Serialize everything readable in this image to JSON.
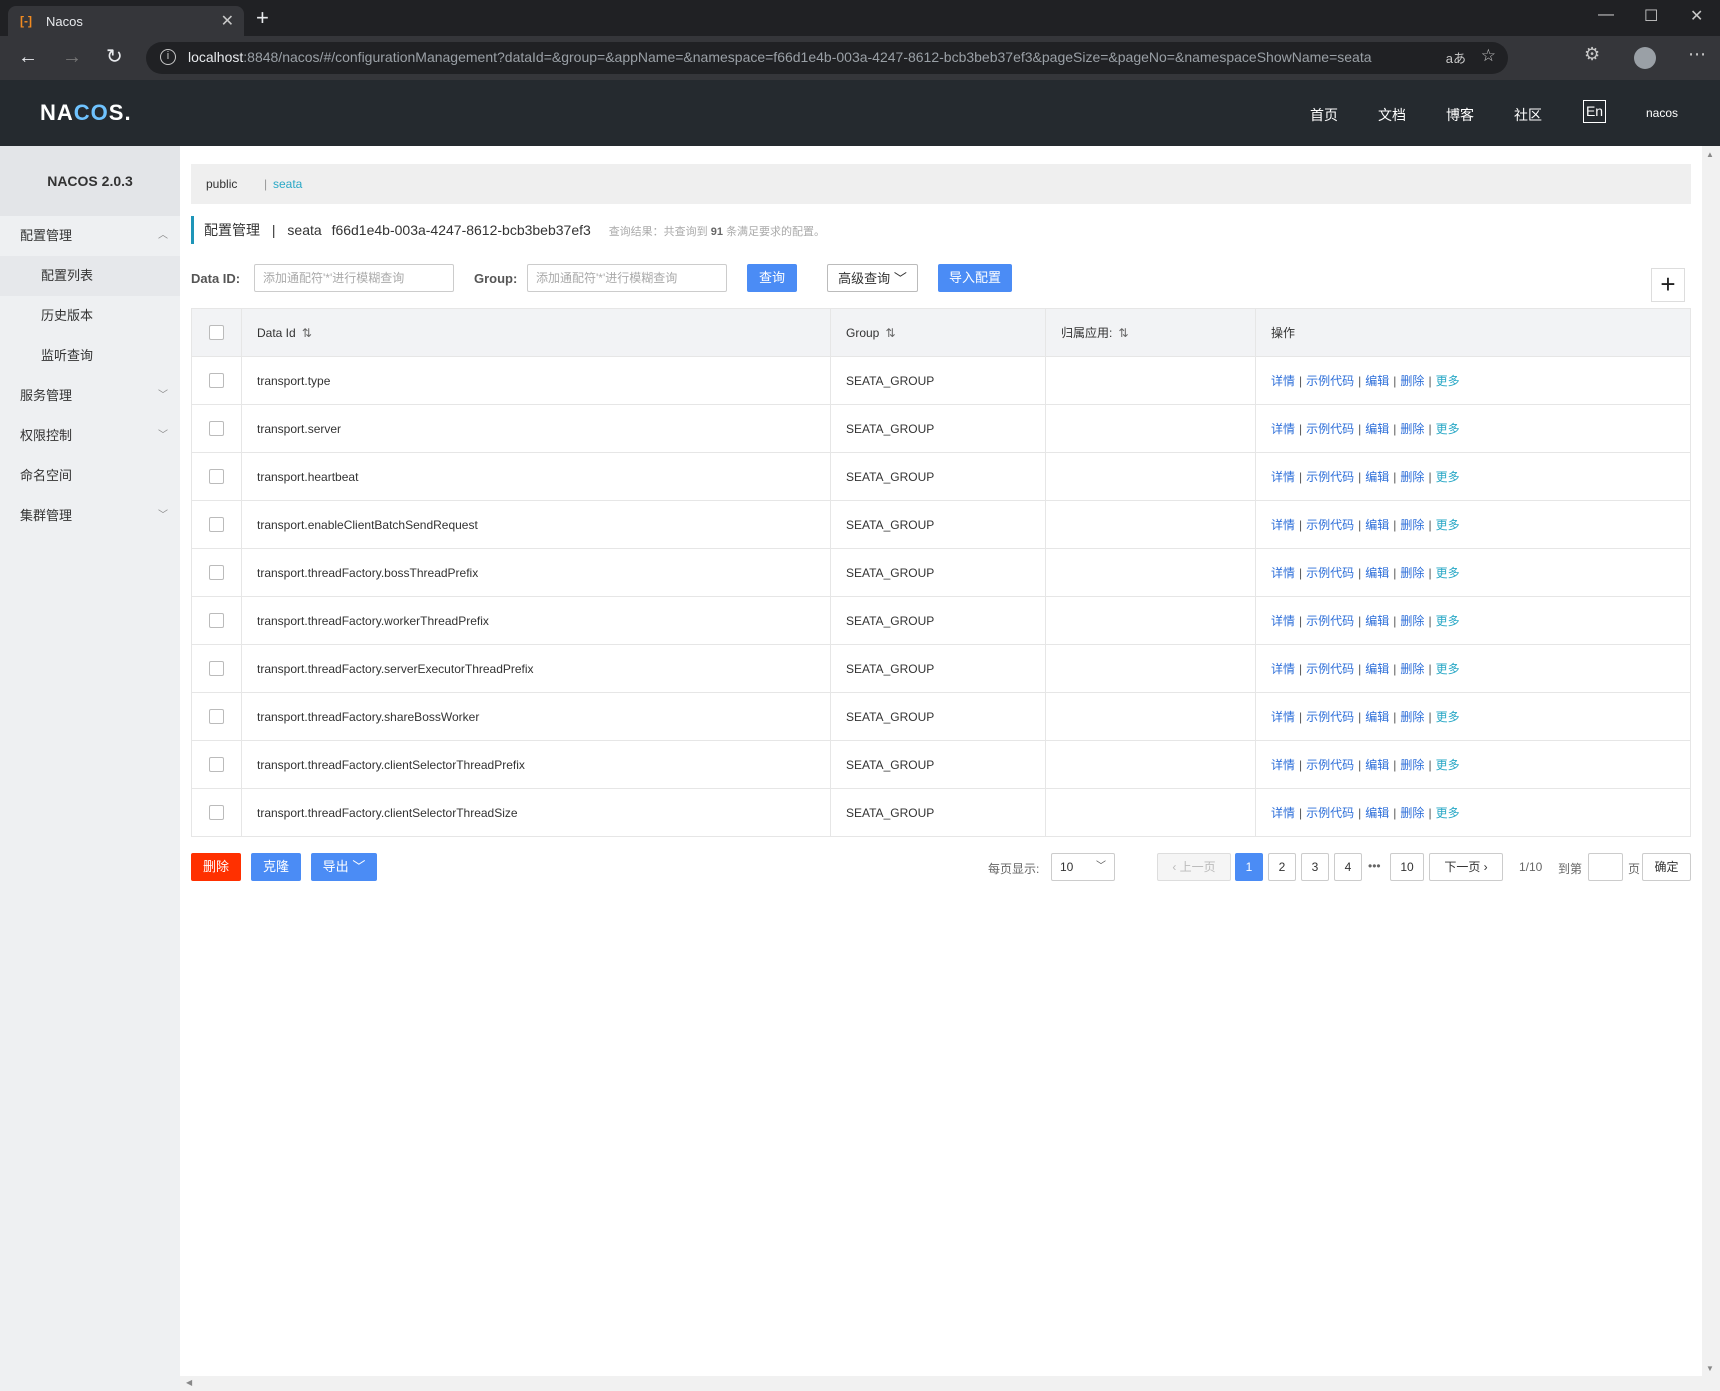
{
  "browser": {
    "tab_title": "Nacos",
    "favicon": "[-]",
    "url_host": "localhost",
    "url_rest": ":8848/nacos/#/configurationManagement?dataId=&group=&appName=&namespace=f66d1e4b-003a-4247-8612-bcb3beb37ef3&pageSize=&pageNo=&namespaceShowName=seata",
    "translate_icon": "aあ"
  },
  "header": {
    "logo_left": "NA",
    "logo_mid": "CO",
    "logo_right": "S.",
    "nav": [
      "首页",
      "文档",
      "博客",
      "社区"
    ],
    "lang": "En",
    "user": "nacos"
  },
  "sidebar": {
    "version": "NACOS 2.0.3",
    "items": [
      {
        "label": "配置管理",
        "type": "group",
        "chevron": "up"
      },
      {
        "label": "配置列表",
        "type": "sub",
        "active": true
      },
      {
        "label": "历史版本",
        "type": "sub"
      },
      {
        "label": "监听查询",
        "type": "sub"
      },
      {
        "label": "服务管理",
        "type": "group",
        "chevron": "down"
      },
      {
        "label": "权限控制",
        "type": "group",
        "chevron": "down"
      },
      {
        "label": "命名空间",
        "type": "group"
      },
      {
        "label": "集群管理",
        "type": "group",
        "chevron": "down"
      }
    ]
  },
  "namespaces": {
    "public": "public",
    "separator": "|",
    "current": "seata"
  },
  "breadcrumb": {
    "title": "配置管理",
    "sep": "|",
    "ns_name": "seata",
    "ns_id": "f66d1e4b-003a-4247-8612-bcb3beb37ef3",
    "result_prefix": "查询结果：共查询到",
    "result_count": "91",
    "result_suffix": "条满足要求的配置。"
  },
  "filters": {
    "dataid_label": "Data ID:",
    "dataid_placeholder": "添加通配符'*'进行模糊查询",
    "group_label": "Group:",
    "group_placeholder": "添加通配符'*'进行模糊查询",
    "search_btn": "查询",
    "advanced_btn": "高级查询",
    "import_btn": "导入配置",
    "add_icon": "+"
  },
  "table": {
    "headers": {
      "data_id": "Data Id",
      "group": "Group",
      "app": "归属应用:",
      "ops": "操作"
    },
    "ops": {
      "detail": "详情",
      "sample": "示例代码",
      "edit": "编辑",
      "delete": "删除",
      "more": "更多"
    },
    "rows": [
      {
        "data_id": "transport.type",
        "group": "SEATA_GROUP",
        "app": ""
      },
      {
        "data_id": "transport.server",
        "group": "SEATA_GROUP",
        "app": ""
      },
      {
        "data_id": "transport.heartbeat",
        "group": "SEATA_GROUP",
        "app": ""
      },
      {
        "data_id": "transport.enableClientBatchSendRequest",
        "group": "SEATA_GROUP",
        "app": ""
      },
      {
        "data_id": "transport.threadFactory.bossThreadPrefix",
        "group": "SEATA_GROUP",
        "app": ""
      },
      {
        "data_id": "transport.threadFactory.workerThreadPrefix",
        "group": "SEATA_GROUP",
        "app": ""
      },
      {
        "data_id": "transport.threadFactory.serverExecutorThreadPrefix",
        "group": "SEATA_GROUP",
        "app": ""
      },
      {
        "data_id": "transport.threadFactory.shareBossWorker",
        "group": "SEATA_GROUP",
        "app": ""
      },
      {
        "data_id": "transport.threadFactory.clientSelectorThreadPrefix",
        "group": "SEATA_GROUP",
        "app": ""
      },
      {
        "data_id": "transport.threadFactory.clientSelectorThreadSize",
        "group": "SEATA_GROUP",
        "app": ""
      }
    ]
  },
  "bottom": {
    "delete_btn": "删除",
    "clone_btn": "克隆",
    "export_btn": "导出",
    "page_size_label": "每页显示:",
    "page_size": "10",
    "prev": "上一页",
    "pages": [
      "1",
      "2",
      "3",
      "4"
    ],
    "ellipsis": "•••",
    "last_page": "10",
    "next": "下一页",
    "page_info": "1/10",
    "goto_label": "到第",
    "page_unit": "页",
    "confirm_btn": "确定"
  }
}
